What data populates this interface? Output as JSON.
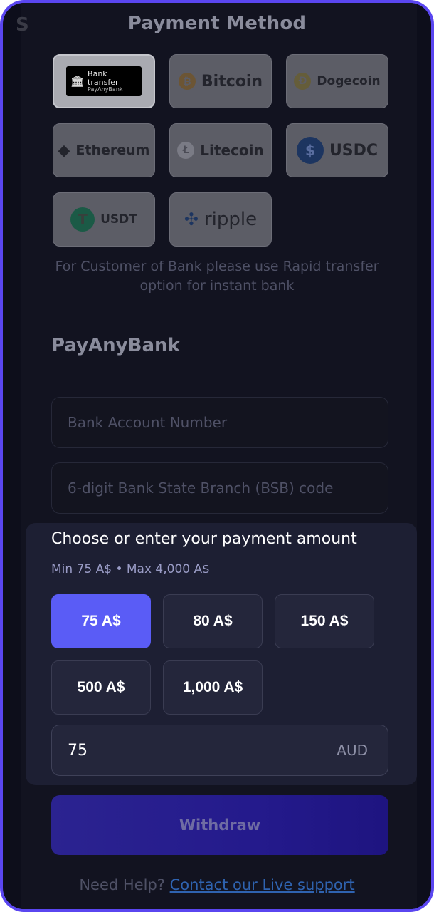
{
  "header": {
    "title": "Payment Method"
  },
  "methods": [
    {
      "id": "bank",
      "line1": "Bank transfer",
      "line2": "PayAnyBank",
      "icon": "bank-icon",
      "selected": true
    },
    {
      "id": "btc",
      "label": "Bitcoin",
      "icon": "bitcoin-icon"
    },
    {
      "id": "doge",
      "label": "Dogecoin",
      "icon": "dogecoin-icon"
    },
    {
      "id": "eth",
      "label": "Ethereum",
      "icon": "ethereum-icon"
    },
    {
      "id": "ltc",
      "label": "Litecoin",
      "icon": "litecoin-icon"
    },
    {
      "id": "usdc",
      "label": "USDC",
      "icon": "usdc-icon"
    },
    {
      "id": "usdt",
      "label": "USDT",
      "icon": "usdt-icon"
    },
    {
      "id": "ripple",
      "label": "ripple",
      "icon": "ripple-icon"
    }
  ],
  "notice": "For Customer of Bank please use Rapid transfer option for instant bank",
  "section": {
    "title": "PayAnyBank"
  },
  "fields": {
    "account_placeholder": "Bank Account Number",
    "bsb_placeholder": "6-digit Bank State Branch (BSB) code"
  },
  "amount": {
    "title": "Choose or enter your payment amount",
    "limits": "Min 75 A$ • Max 4,000 A$",
    "presets": [
      "75 A$",
      "80 A$",
      "150 A$",
      "500 A$",
      "1,000 A$"
    ],
    "value": "75",
    "currency": "AUD"
  },
  "actions": {
    "withdraw": "Withdraw"
  },
  "help": {
    "prefix": "Need Help?",
    "link": "Contact our Live support"
  },
  "colors": {
    "accent": "#5a5cf6",
    "frame": "#5a46f0",
    "background": "#0d0e1b"
  }
}
